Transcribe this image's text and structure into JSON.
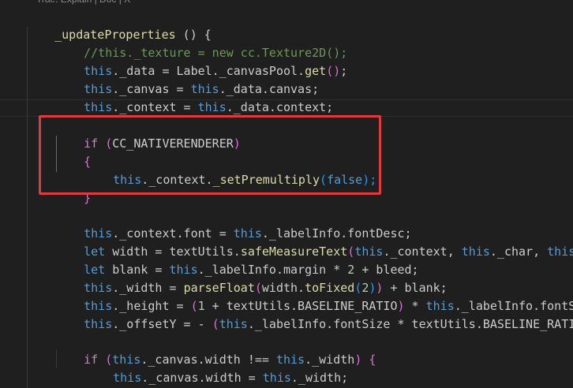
{
  "codelens": "Trae: Explain | Doc | X",
  "colors": {
    "background": "#1f1f1f",
    "highlight_box": "#e0393e",
    "keyword": "#569cd6",
    "control": "#c586c0",
    "function": "#dcdcaa",
    "number": "#b5cea8",
    "comment": "#6a9955"
  },
  "code": {
    "l1": [
      "_updateProperties",
      " () {"
    ],
    "l2": [
      "//this._texture = new cc.Texture2D();"
    ],
    "l3": [
      "this",
      "._data = Label._canvasPool.",
      "get",
      "(",
      ")",
      ";"
    ],
    "l4": [
      "this",
      "._canvas = ",
      "this",
      "._data.canvas;"
    ],
    "l5": [
      "this",
      "._context = ",
      "this",
      "._data.context;"
    ],
    "l6": [
      "if",
      " (",
      "CC_NATIVERENDERER",
      ")"
    ],
    "l7": [
      "{"
    ],
    "l8": [
      "this",
      "._context.",
      "_setPremultiply",
      "(",
      "false",
      ");"
    ],
    "l9": [
      "}"
    ],
    "l10": [
      "this",
      "._context.font = ",
      "this",
      "._labelInfo.fontDesc;"
    ],
    "l11": [
      "let",
      " width = textUtils.",
      "safeMeasureText",
      "(",
      "this",
      "._context, ",
      "this",
      "._char, ",
      "this",
      "._"
    ],
    "l12": [
      "let",
      " blank = ",
      "this",
      "._labelInfo.margin * ",
      "2",
      " + bleed;"
    ],
    "l13": [
      "this",
      "._width = ",
      "parseFloat",
      "(",
      "width.",
      "toFixed",
      "(",
      "2",
      ")",
      ")",
      " + blank;"
    ],
    "l14": [
      "this",
      "._height = ",
      "(",
      "1",
      " + textUtils.BASELINE_RATIO",
      ")",
      " * ",
      "this",
      "._labelInfo.fontSiz"
    ],
    "l15": [
      "this",
      "._offsetY = - ",
      "(",
      "this",
      "._labelInfo.fontSize * textUtils.BASELINE_RATIO",
      ")"
    ],
    "l16": [
      "if",
      " (",
      "this",
      "._canvas.width !== ",
      "this",
      "._width",
      ")",
      " {"
    ],
    "l17": [
      "this",
      "._canvas.width = ",
      "this",
      "._width;"
    ],
    "l18": [
      "}"
    ]
  }
}
